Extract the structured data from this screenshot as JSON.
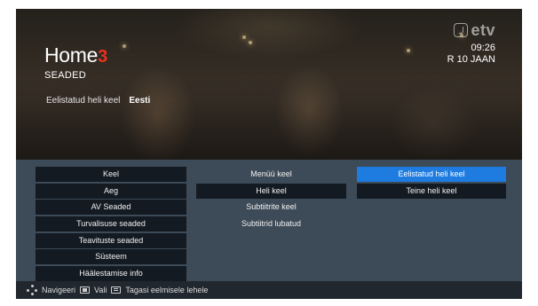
{
  "header": {
    "brand_name": "Home",
    "brand_number": "3",
    "section_title": "SEADED",
    "time": "09:26",
    "date": "R 10 JAAN",
    "channel_logo": "etv"
  },
  "current_setting": {
    "label": "Eelistatud heli keel",
    "value": "Eesti"
  },
  "menu": {
    "column1": [
      {
        "label": "Keel"
      },
      {
        "label": "Aeg"
      },
      {
        "label": "AV Seaded"
      },
      {
        "label": "Turvalisuse seaded"
      },
      {
        "label": "Teavituste seaded"
      },
      {
        "label": "Süsteem"
      },
      {
        "label": "Häälestamise info"
      }
    ],
    "column2": [
      {
        "label": "Menüü keel"
      },
      {
        "label": "Heli keel"
      },
      {
        "label": "Subtiitrite keel"
      },
      {
        "label": "Subtiitrid lubatud"
      }
    ],
    "column3": [
      {
        "label": "Eelistatud heli keel"
      },
      {
        "label": "Teine heli keel"
      }
    ]
  },
  "footer": {
    "navigate_label": "Navigeeri",
    "select_label": "Vali",
    "back_label": "Tagasi eelmisele lehele"
  },
  "colors": {
    "accent_brand": "#e8321e",
    "selection": "#1e7be0",
    "panel": "#3d4a57",
    "item_dark": "#131a22"
  },
  "icons": {
    "navigate": "dpad-icon",
    "select": "ok-button-icon",
    "back": "back-button-icon"
  }
}
